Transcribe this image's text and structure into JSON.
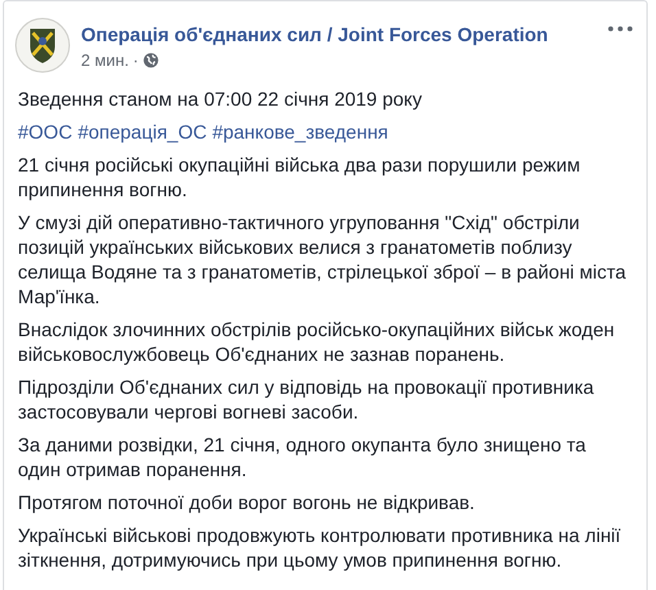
{
  "post": {
    "author": "Операція об'єднаних сил / Joint Forces Operation",
    "time": "2 мин.",
    "separator": "·",
    "headline": "Зведення станом на 07:00 22 січня 2019 року",
    "hashtags": [
      "#ООС",
      "#операція_ОС",
      "#ранкове_зведення"
    ],
    "paragraphs": [
      "21 січня російські окупаційні війська два рази порушили режим припинення вогню.",
      "У смузі дій оперативно-тактичного угруповання \"Схід\" обстріли позицій українських військових велися з гранатометів поблизу селища Водяне та з гранатометів, стрілецької зброї – в районі міста Мар'їнка.",
      "Внаслідок злочинних обстрілів російсько-окупаційних військ жоден військовослужбовець Об'єднаних не зазнав поранень.",
      "Підрозділи Об'єднаних сил у відповідь на провокації противника застосовували чергові вогневі засоби.",
      "За даними розвідки, 21 січня, одного окупанта було знищено та один отримав поранення.",
      "Протягом поточної доби ворог вогонь не відкривав.",
      "Українські військові продовжують контролювати противника на лінії зіткнення, дотримуючись при цьому умов припинення вогню."
    ]
  }
}
